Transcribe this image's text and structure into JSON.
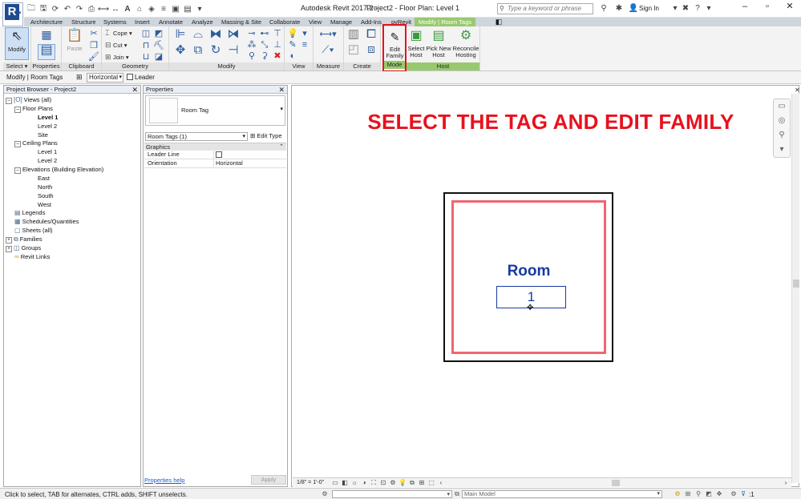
{
  "titlebar": {
    "app_title": "Autodesk Revit 2017.2 -",
    "doc_title": "Project2 - Floor Plan: Level 1",
    "search_placeholder": "Type a keyword or phrase",
    "sign_in": "Sign In",
    "help": "?"
  },
  "ribbon_tabs": [
    {
      "label": "Architecture"
    },
    {
      "label": "Structure"
    },
    {
      "label": "Systems"
    },
    {
      "label": "Insert"
    },
    {
      "label": "Annotate"
    },
    {
      "label": "Analyze"
    },
    {
      "label": "Massing & Site"
    },
    {
      "label": "Collaborate"
    },
    {
      "label": "View"
    },
    {
      "label": "Manage"
    },
    {
      "label": "Add-Ins"
    },
    {
      "label": "pyRevit"
    },
    {
      "label": "Modify | Room Tags"
    }
  ],
  "ribbon": {
    "select_panel": {
      "label": "Select",
      "modify": "Modify"
    },
    "properties_panel": {
      "label": "Properties"
    },
    "clipboard_panel": {
      "label": "Clipboard",
      "paste": "Paste"
    },
    "geometry_panel": {
      "label": "Geometry",
      "cope": "Cope",
      "cut": "Cut",
      "join": "Join"
    },
    "modify_panel": {
      "label": "Modify"
    },
    "view_panel": {
      "label": "View"
    },
    "measure_panel": {
      "label": "Measure"
    },
    "create_panel": {
      "label": "Create"
    },
    "mode_panel": {
      "label": "Mode",
      "edit_family_1": "Edit",
      "edit_family_2": "Family"
    },
    "host_panel": {
      "label": "Host",
      "select_host_1": "Select",
      "select_host_2": "Host",
      "pick_new_host_1": "Pick New",
      "pick_new_host_2": "Host",
      "reconcile_hosting_1": "Reconcile",
      "reconcile_hosting_2": "Hosting"
    },
    "highlight_color": "#e8111d"
  },
  "options_bar": {
    "context": "Modify | Room Tags",
    "orientation": "Horizontal",
    "leader_label": "Leader"
  },
  "project_browser": {
    "title": "Project Browser - Project2",
    "tree": [
      {
        "label": "Views (all)"
      },
      {
        "label": "Floor Plans"
      },
      {
        "label": "Level 1"
      },
      {
        "label": "Level 2"
      },
      {
        "label": "Site"
      },
      {
        "label": "Ceiling Plans"
      },
      {
        "label": "Level 1"
      },
      {
        "label": "Level 2"
      },
      {
        "label": "Elevations (Building Elevation)"
      },
      {
        "label": "East"
      },
      {
        "label": "North"
      },
      {
        "label": "South"
      },
      {
        "label": "West"
      },
      {
        "label": "Legends"
      },
      {
        "label": "Schedules/Quantities"
      },
      {
        "label": "Sheets (all)"
      },
      {
        "label": "Families"
      },
      {
        "label": "Groups"
      },
      {
        "label": "Revit Links"
      }
    ]
  },
  "properties": {
    "title": "Properties",
    "type_name": "Room Tag",
    "instance_filter": "Room Tags (1)",
    "edit_type": "Edit Type",
    "group_graphics": "Graphics",
    "rows": [
      {
        "key": "Leader Line",
        "value": ""
      },
      {
        "key": "Orientation",
        "value": "Horizontal"
      }
    ],
    "help_link": "Properties help",
    "apply": "Apply"
  },
  "view": {
    "headline": "SELECT THE TAG AND EDIT FAMILY",
    "room_name": "Room",
    "room_number": "1",
    "scale": "1/8\" = 1'-0\"",
    "headline_color": "#e8111d",
    "room_text_color": "#1a3aa0"
  },
  "statusbar": {
    "text": "Click to select, TAB for alternates, CTRL adds, SHIFT unselects.",
    "model": "Main Model",
    "filter_count": ":1"
  }
}
